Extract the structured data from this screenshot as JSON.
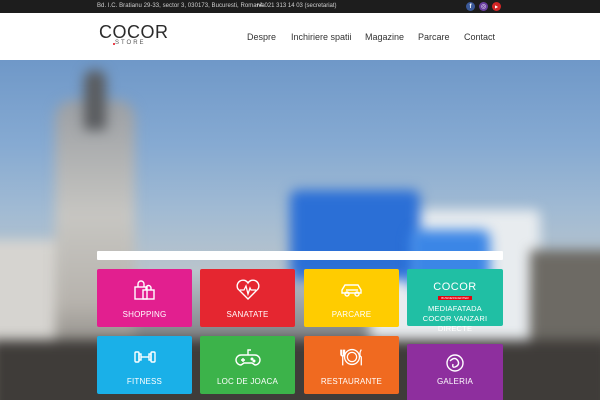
{
  "topbar": {
    "address": "Bd. I.C. Bratianu 29-33, sector 3, 030173, Bucuresti, Romania",
    "phone": "+4 021 313 14 03 (secretariat)",
    "social": [
      {
        "icon": "facebook-icon",
        "glyph": "f",
        "color": "#3b5998"
      },
      {
        "icon": "instagram-icon",
        "glyph": "◎",
        "color": "#6a3fa0"
      },
      {
        "icon": "youtube-icon",
        "glyph": "▶",
        "color": "#d42626"
      }
    ]
  },
  "header": {
    "logo_main": "COCOR",
    "logo_sub": "STORE",
    "nav": [
      "Despre",
      "Inchiriere spatii",
      "Magazine",
      "Parcare",
      "Contact"
    ]
  },
  "tiles": {
    "shopping": {
      "label": "SHOPPING",
      "icon": "shopping-bags-icon",
      "color": "#e21f8f"
    },
    "sanatate": {
      "label": "SANATATE",
      "icon": "heart-pulse-icon",
      "color": "#e52630"
    },
    "parcare": {
      "label": "PARCARE",
      "icon": "car-icon",
      "color": "#ffcc00"
    },
    "media": {
      "logo": "COCOR",
      "logo_sub": "BUSINESSCENTER",
      "label_lines": [
        "MEDIAFATADA",
        "COCOR VANZARI",
        "DIRECTE"
      ],
      "color": "#20bfa4"
    },
    "fitness": {
      "label": "FITNESS",
      "icon": "dumbbell-icon",
      "color": "#1ab0e8"
    },
    "loc_de_joaca": {
      "label": "LOC DE JOACA",
      "icon": "gamepad-icon",
      "color": "#3cb34a"
    },
    "restaurante": {
      "label": "RESTAURANTE",
      "icon": "plate-cutlery-icon",
      "color": "#f06a20"
    },
    "galeria": {
      "label": "GALERIA",
      "icon": "galeria-logo-icon",
      "color": "#8e2f9e"
    }
  }
}
